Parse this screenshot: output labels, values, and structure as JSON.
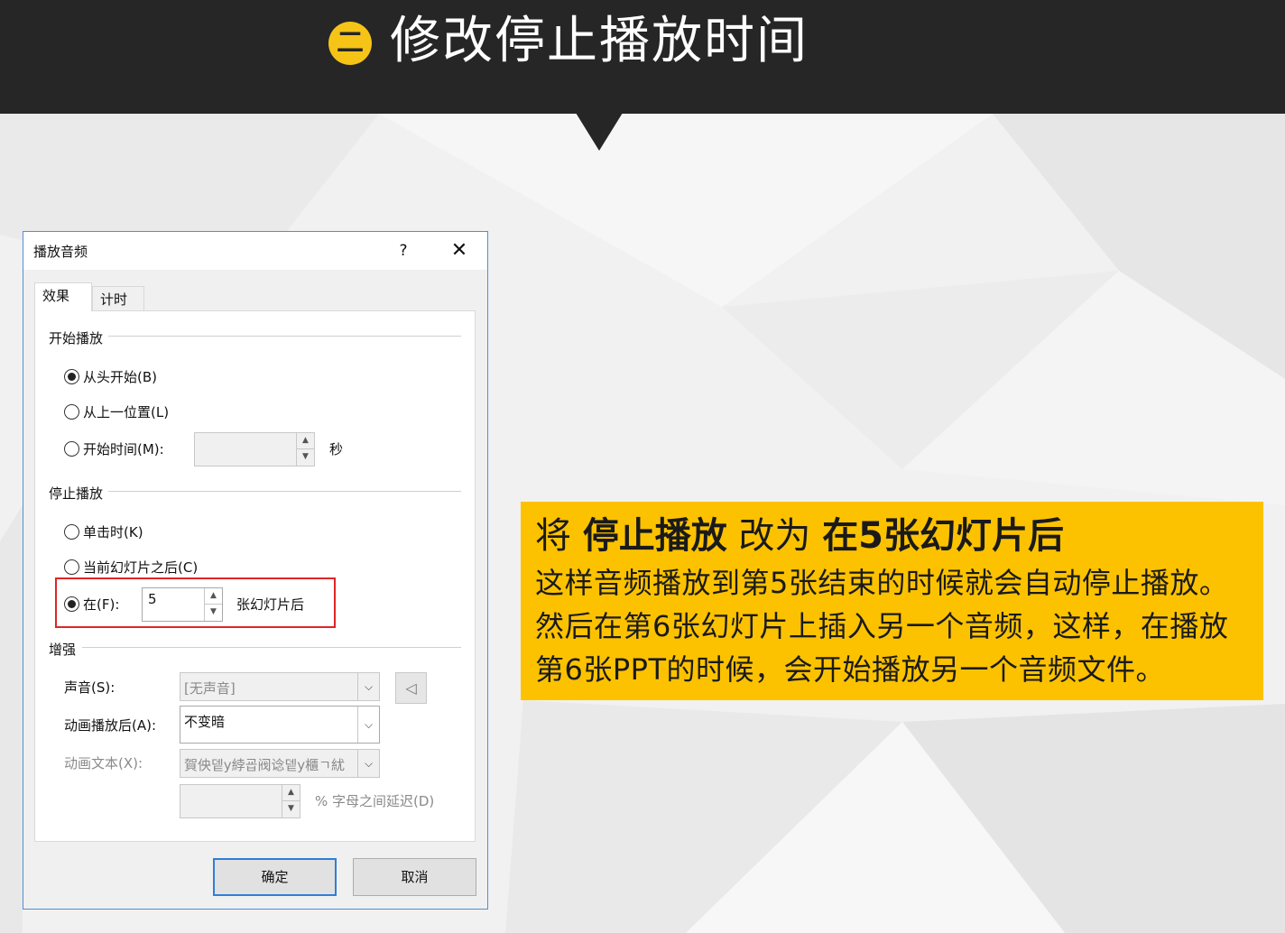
{
  "banner": {
    "badge": "二",
    "title": "修改停止播放时间"
  },
  "dialog": {
    "title": "播放音频",
    "help": "?",
    "close": "✕",
    "tabs": [
      {
        "label": "效果",
        "active": true
      },
      {
        "label": "计时",
        "active": false
      }
    ],
    "start_group": {
      "label": "开始播放",
      "options": [
        {
          "label": "从头开始(B)",
          "checked": true
        },
        {
          "label": "从上一位置(L)",
          "checked": false
        },
        {
          "label": "开始时间(M):",
          "checked": false
        }
      ],
      "time_value": "",
      "time_unit": "秒"
    },
    "stop_group": {
      "label": "停止播放",
      "options": [
        {
          "label": "单击时(K)",
          "checked": false
        },
        {
          "label": "当前幻灯片之后(C)",
          "checked": false
        },
        {
          "label": "在(F):",
          "checked": true
        }
      ],
      "slides_value": "5",
      "slides_suffix": "张幻灯片后"
    },
    "enhance_group": {
      "label": "增强",
      "sound_label": "声音(S):",
      "sound_value": "[无声音]",
      "after_label": "动画播放后(A):",
      "after_value": "不变暗",
      "text_label": "动画文本(X):",
      "text_value": "賀佒뎉y綍굡阀谂뎉y櫃ㄱ紌",
      "delay_value": "",
      "delay_suffix": "% 字母之间延迟(D)"
    },
    "ok": "确定",
    "cancel": "取消"
  },
  "callout": {
    "l1_a": "将 ",
    "l1_b": "停止播放",
    "l1_c": " 改为 ",
    "l1_d": "在5张幻灯片后",
    "l2": "这样音频播放到第5张结束的时候就会自动停止播放。",
    "l3": "然后在第6张幻灯片上插入另一个音频，这样，在播放",
    "l4": "第6张PPT的时候，会开始播放另一个音频文件。"
  },
  "colors": {
    "banner": "#262626",
    "badge": "#f6c417",
    "callout": "#fcc200",
    "highlight": "#e02525"
  }
}
